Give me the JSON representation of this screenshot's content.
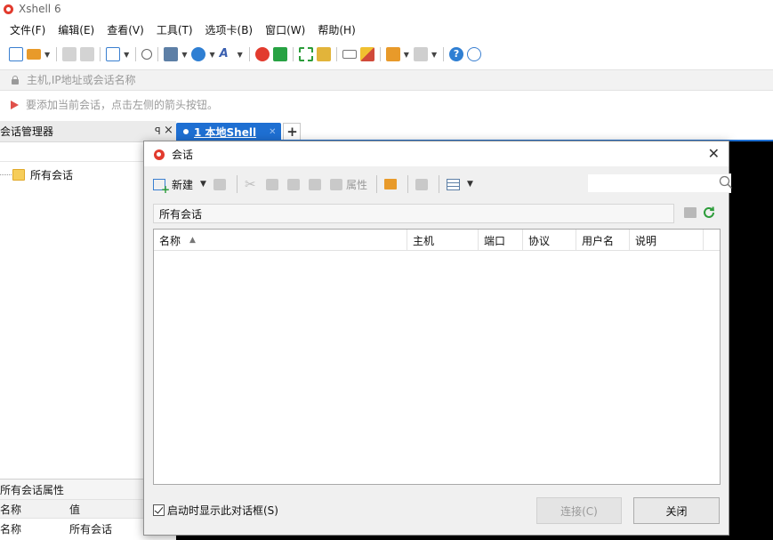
{
  "app": {
    "title": "Xshell 6"
  },
  "menu": [
    "文件(F)",
    "编辑(E)",
    "查看(V)",
    "工具(T)",
    "选项卡(B)",
    "窗口(W)",
    "帮助(H)"
  ],
  "address": {
    "placeholder": "主机,IP地址或会话名称"
  },
  "hint": {
    "text": "要添加当前会话，点击左侧的箭头按钮。"
  },
  "session_manager": {
    "title": "会话管理器",
    "tree": [
      {
        "label": "所有会话"
      }
    ]
  },
  "tabs": [
    {
      "label": "1 本地Shell"
    }
  ],
  "properties": {
    "title": "所有会话属性",
    "headers": [
      "名称",
      "值"
    ],
    "rows": [
      {
        "name": "名称",
        "value": "所有会话"
      }
    ]
  },
  "dialog": {
    "title": "会话",
    "toolbar": {
      "new_label": "新建",
      "props_label": "属性"
    },
    "path": "所有会话",
    "columns": [
      "名称",
      "主机",
      "端口",
      "协议",
      "用户名",
      "说明"
    ],
    "startup_checkbox": {
      "label": "启动时显示此对话框(S)",
      "checked": true
    },
    "buttons": {
      "connect": "连接(C)",
      "close": "关闭"
    }
  },
  "colors": {
    "accent": "#1e6fd2",
    "logo": "#e23b2e"
  }
}
